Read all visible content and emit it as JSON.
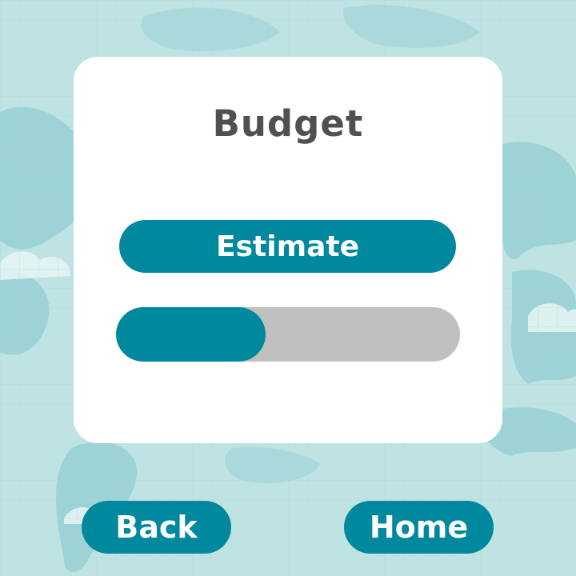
{
  "screen": {
    "title": "Budget",
    "background_color": "#bfe3e3",
    "accent_color": "#00889f"
  },
  "estimate_button": {
    "label": "Estimate"
  },
  "progress": {
    "fraction": 0.435,
    "fill_color": "#00889f",
    "track_color": "#c0c0c0"
  },
  "navigation": {
    "back_label": "Back",
    "home_label": "Home"
  }
}
